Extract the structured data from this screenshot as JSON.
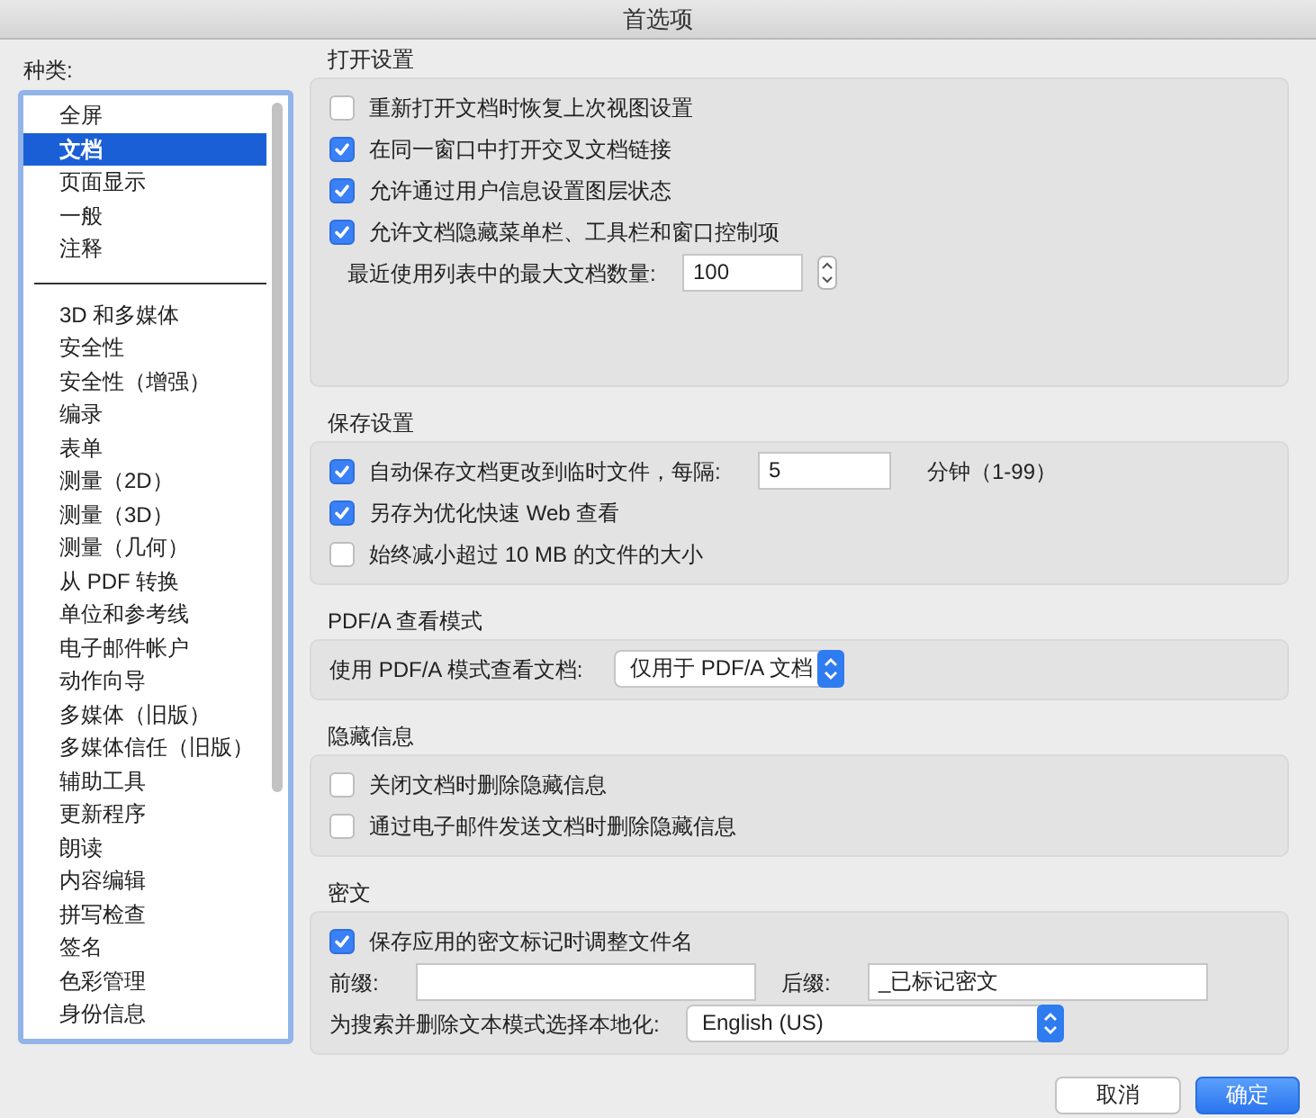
{
  "window": {
    "title": "首选项"
  },
  "sidebar": {
    "label": "种类:",
    "groups": [
      {
        "items": [
          {
            "label": "全屏",
            "selected": false
          },
          {
            "label": "文档",
            "selected": true
          },
          {
            "label": "页面显示",
            "selected": false
          },
          {
            "label": "一般",
            "selected": false
          },
          {
            "label": "注释",
            "selected": false
          }
        ]
      },
      {
        "items": [
          {
            "label": "3D 和多媒体",
            "selected": false
          },
          {
            "label": "安全性",
            "selected": false
          },
          {
            "label": "安全性（增强）",
            "selected": false
          },
          {
            "label": "编录",
            "selected": false
          },
          {
            "label": "表单",
            "selected": false
          },
          {
            "label": "测量（2D）",
            "selected": false
          },
          {
            "label": "测量（3D）",
            "selected": false
          },
          {
            "label": "测量（几何）",
            "selected": false
          },
          {
            "label": "从 PDF 转换",
            "selected": false
          },
          {
            "label": "单位和参考线",
            "selected": false
          },
          {
            "label": "电子邮件帐户",
            "selected": false
          },
          {
            "label": "动作向导",
            "selected": false
          },
          {
            "label": "多媒体（旧版）",
            "selected": false
          },
          {
            "label": "多媒体信任（旧版）",
            "selected": false
          },
          {
            "label": "辅助工具",
            "selected": false
          },
          {
            "label": "更新程序",
            "selected": false
          },
          {
            "label": "朗读",
            "selected": false
          },
          {
            "label": "内容编辑",
            "selected": false
          },
          {
            "label": "拼写检查",
            "selected": false
          },
          {
            "label": "签名",
            "selected": false
          },
          {
            "label": "色彩管理",
            "selected": false
          },
          {
            "label": "身份信息",
            "selected": false
          }
        ]
      }
    ]
  },
  "sections": [
    {
      "heading": "打开设置",
      "rows": [
        {
          "kind": "checkbox",
          "label": "重新打开文档时恢复上次视图设置",
          "checked": false
        },
        {
          "kind": "checkbox",
          "label": "在同一窗口中打开交叉文档链接",
          "checked": true
        },
        {
          "kind": "checkbox",
          "label": "允许通过用户信息设置图层状态",
          "checked": true
        },
        {
          "kind": "checkbox",
          "label": "允许文档隐藏菜单栏、工具栏和窗口控制项",
          "checked": true
        },
        {
          "kind": "stepper",
          "label": "最近使用列表中的最大文档数量:",
          "value": "100"
        }
      ]
    },
    {
      "heading": "保存设置",
      "rows": [
        {
          "kind": "checkbox_input",
          "label": "自动保存文档更改到临时文件，每隔:",
          "checked": true,
          "value": "5",
          "unit": "分钟（1-99）"
        },
        {
          "kind": "checkbox",
          "label": "另存为优化快速 Web 查看",
          "checked": true
        },
        {
          "kind": "checkbox",
          "label": "始终减小超过 10 MB 的文件的大小",
          "checked": false
        }
      ]
    },
    {
      "heading": "PDF/A 查看模式",
      "rows": [
        {
          "kind": "select",
          "label": "使用 PDF/A 模式查看文档:",
          "value": "仅用于 PDF/A 文档"
        }
      ]
    },
    {
      "heading": "隐藏信息",
      "rows": [
        {
          "kind": "checkbox",
          "label": "关闭文档时删除隐藏信息",
          "checked": false
        },
        {
          "kind": "checkbox",
          "label": "通过电子邮件发送文档时删除隐藏信息",
          "checked": false
        }
      ]
    },
    {
      "heading": "密文",
      "rows": [
        {
          "kind": "checkbox",
          "label": "保存应用的密文标记时调整文件名",
          "checked": true
        },
        {
          "kind": "fields",
          "fields": [
            {
              "label": "前缀:"
            },
            {
              "label": "后缀:",
              "value": "_已标记密文"
            }
          ]
        },
        {
          "kind": "select",
          "label": "为搜索并删除文本模式选择本地化:",
          "value": "English (US)",
          "wide": true
        }
      ]
    }
  ],
  "buttons": [
    {
      "label": "取消",
      "default": false
    },
    {
      "label": "确定",
      "default": true
    }
  ]
}
